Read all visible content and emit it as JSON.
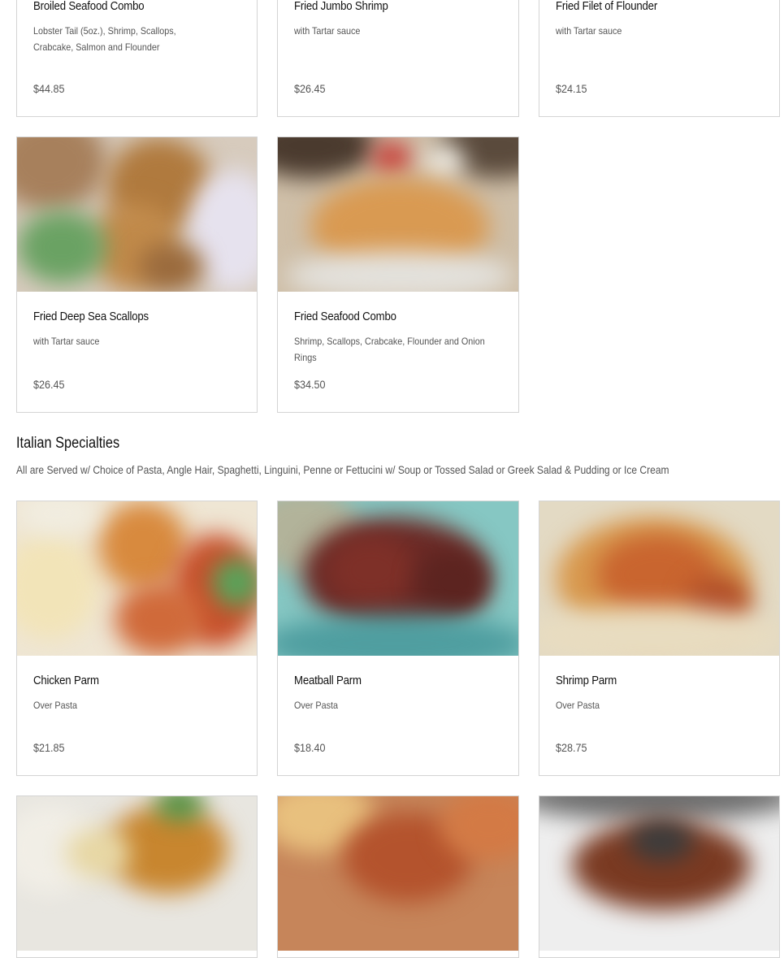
{
  "seafood": {
    "items": [
      {
        "name": "Broiled Seafood Combo",
        "desc": "Lobster Tail (5oz.), Shrimp, Scallops, Crabcake, Salmon and Flounder",
        "price": "$44.85"
      },
      {
        "name": "Fried Jumbo Shrimp",
        "desc": "with Tartar sauce",
        "price": "$26.45"
      },
      {
        "name": "Fried Filet of Flounder",
        "desc": "with Tartar sauce",
        "price": "$24.15"
      },
      {
        "name": "Fried Deep Sea Scallops",
        "desc": "with Tartar sauce",
        "price": "$26.45"
      },
      {
        "name": "Fried Seafood Combo",
        "desc": "Shrimp, Scallops, Crabcake, Flounder and Onion Rings",
        "price": "$34.50"
      }
    ]
  },
  "italian": {
    "title": "Italian Specialties",
    "subtitle": "All are Served w/ Choice of Pasta, Angle Hair, Spaghetti, Linguini, Penne or Fettucini w/ Soup or Tossed Salad or Greek Salad & Pudding or Ice Cream",
    "items": [
      {
        "name": "Chicken Parm",
        "desc": "Over Pasta",
        "price": "$21.85"
      },
      {
        "name": "Meatball Parm",
        "desc": "Over Pasta",
        "price": "$18.40"
      },
      {
        "name": "Shrimp Parm",
        "desc": "Over Pasta",
        "price": "$28.75"
      }
    ]
  }
}
